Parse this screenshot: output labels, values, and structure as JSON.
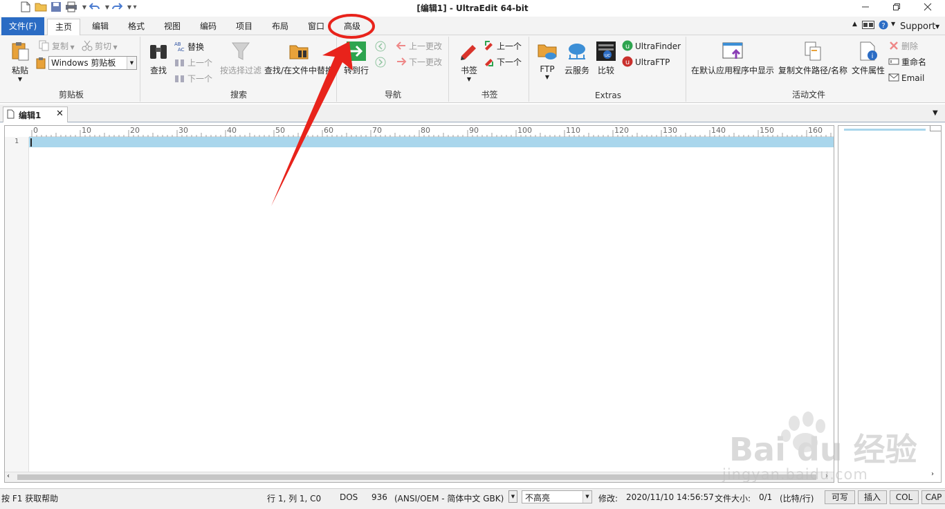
{
  "window": {
    "title": "[编辑1] - UltraEdit 64-bit",
    "controls": [
      "minimize",
      "maximize",
      "close"
    ]
  },
  "quick_access": [
    "new-file-icon",
    "open-folder-icon",
    "save-icon",
    "print-icon",
    "undo-icon",
    "redo-icon",
    "customize-icon"
  ],
  "tabs": {
    "file": "文件(F)",
    "home": "主页",
    "edit": "编辑",
    "format": "格式",
    "view": "视图",
    "coding": "编码",
    "project": "项目",
    "layout": "布局",
    "window": "窗口",
    "advanced": "高级"
  },
  "right_top": {
    "support": "Support"
  },
  "ribbon": {
    "clipboard": {
      "label": "剪贴板",
      "paste": "粘贴",
      "copy": "复制",
      "cut": "剪切",
      "clipboard_select": "Windows 剪贴板"
    },
    "search": {
      "label": "搜索",
      "find": "查找",
      "replace": "替换",
      "prev": "上一个",
      "next": "下一个",
      "filter": "按选择过滤",
      "find_in_files": "查找/在文件中替换"
    },
    "navigate": {
      "label": "导航",
      "goto": "转到行",
      "prev_change": "上一更改",
      "next_change": "下一更改"
    },
    "bookmarks": {
      "label": "书签",
      "bookmark": "书签",
      "prev": "上一个",
      "next": "下一个"
    },
    "extras": {
      "label": "Extras",
      "ftp": "FTP",
      "cloud": "云服务",
      "compare": "比较",
      "ultrafinder": "UltraFinder",
      "ultraftp": "UltraFTP"
    },
    "active_file": {
      "label": "活动文件",
      "show_default": "在默认应用程序中显示",
      "copy_path": "复制文件路径/名称",
      "properties": "文件属性",
      "delete": "删除",
      "rename": "重命名",
      "email": "Email"
    }
  },
  "doc_tab": {
    "name": "编辑1"
  },
  "ruler": {
    "ticks": [
      "0",
      "10",
      "20",
      "30",
      "40",
      "50",
      "60",
      "70",
      "80",
      "90",
      "100",
      "110",
      "120",
      "130",
      "140",
      "150",
      "160"
    ]
  },
  "editor": {
    "line_number": "1"
  },
  "status": {
    "help": "按 F1 获取帮助",
    "position": "行 1, 列 1, C0",
    "line_ending": "DOS",
    "codepage": "936",
    "encoding": "(ANSI/OEM - 简体中文 GBK)",
    "highlight": "不高亮",
    "modified": "修改:",
    "modified_time": "2020/11/10 14:56:57",
    "file_size_label": "文件大小:",
    "file_size": "0/1",
    "file_size_unit": "(比特/行)",
    "writable": "可写",
    "insert": "插入",
    "col": "COL",
    "cap": "CAP"
  },
  "watermark": {
    "text": "Bai du 经验",
    "url": "jingyan.baidu.com"
  },
  "colors": {
    "accent": "#2b6cc4",
    "current_line": "#a9d6ec",
    "annotation": "#e8231b"
  }
}
